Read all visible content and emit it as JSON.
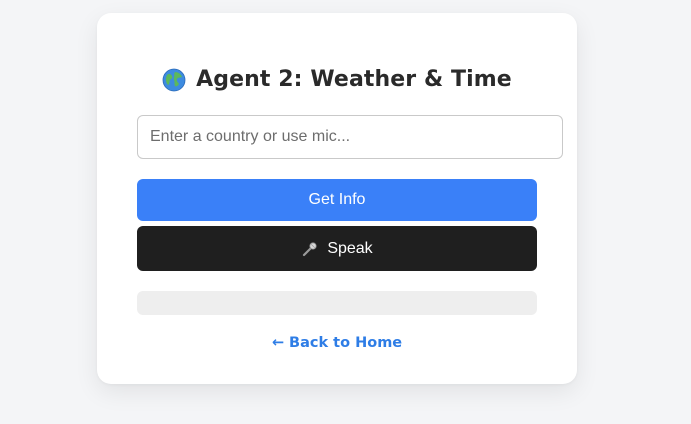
{
  "card": {
    "title": "Agent 2: Weather & Time",
    "title_icon": "globe-icon",
    "input_placeholder": "Enter a country or use mic...",
    "input_value": "",
    "get_info_label": "Get Info",
    "speak_label": "Speak",
    "speak_icon": "microphone-icon",
    "output_text": "",
    "back_link": "← Back to Home"
  },
  "colors": {
    "primary": "#3a80f8",
    "dark_button": "#1f1f1f",
    "link": "#2e7de6",
    "page_background": "#f4f5f7"
  }
}
